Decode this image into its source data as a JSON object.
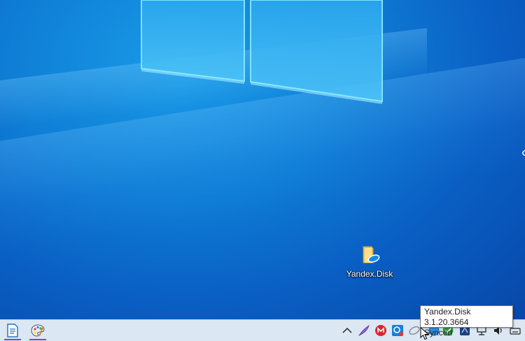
{
  "desktop": {
    "icons": [
      {
        "label": "Yandex.Disk",
        "icon": "yandex-disk-folder-icon"
      }
    ]
  },
  "taskbar": {
    "apps": [
      {
        "name": "notepad",
        "icon": "notepad-icon"
      },
      {
        "name": "paint",
        "icon": "paint-palette-icon"
      }
    ],
    "tray": [
      {
        "icon": "chevron-up-icon"
      },
      {
        "icon": "feather-pen-icon"
      },
      {
        "icon": "mega-icon"
      },
      {
        "icon": "shield-icon"
      },
      {
        "icon": "yandex-disk-tray-icon"
      },
      {
        "icon": "globe-icon"
      },
      {
        "icon": "checkmark-icon"
      },
      {
        "icon": "security-icon"
      },
      {
        "icon": "network-icon"
      },
      {
        "icon": "volume-icon"
      },
      {
        "icon": "keyboard-icon"
      }
    ]
  },
  "tooltip": {
    "line1": "Yandex.Disk 3.1.20.3664",
    "line2": "Synced"
  },
  "colors": {
    "desktop_bg": "#0f7fd6",
    "taskbar_bg": "#dbe7f2",
    "accent": "#8a3fd1"
  }
}
